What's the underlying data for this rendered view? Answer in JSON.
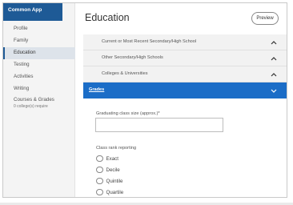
{
  "sidebar": {
    "brand": "Common App",
    "items": [
      {
        "label": "Profile"
      },
      {
        "label": "Family"
      },
      {
        "label": "Education",
        "active": true
      },
      {
        "label": "Testing"
      },
      {
        "label": "Activities"
      },
      {
        "label": "Writing"
      },
      {
        "label": "Courses & Grades",
        "sub": "0 college(s) require"
      }
    ]
  },
  "header": {
    "title": "Education",
    "preview_label": "Preview"
  },
  "sections": [
    {
      "label": "Current or Most Recent Secondary/High School",
      "expanded": false
    },
    {
      "label": "Other Secondary/High Schools",
      "expanded": false
    },
    {
      "label": "Colleges & Universities",
      "expanded": false
    },
    {
      "label": "Grades",
      "expanded": true
    }
  ],
  "grades_form": {
    "class_size_label": "Graduating class size (approx.)*",
    "class_size_value": "",
    "rank_label": "Class rank reporting",
    "rank_options": [
      "Exact",
      "Decile",
      "Quintile",
      "Quartile"
    ]
  },
  "colors": {
    "brand": "#1e5a96",
    "accent": "#1b6dc7",
    "sidebar_bg": "#f4f4f4",
    "section_bg": "#f2f2f2"
  },
  "icons": {
    "collapsed": "chevron-up-icon",
    "expanded": "chevron-down-icon"
  }
}
